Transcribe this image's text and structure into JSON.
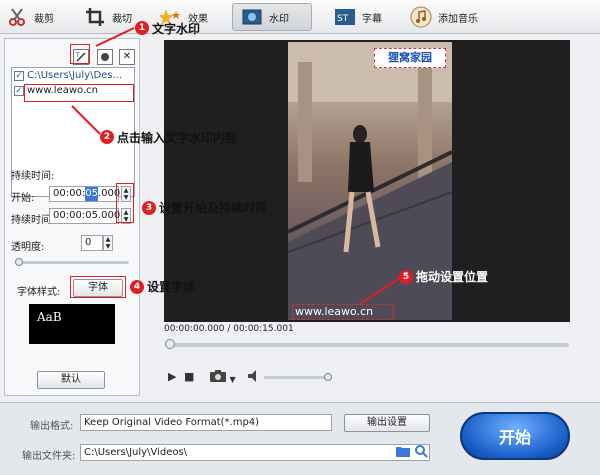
{
  "toolbar": {
    "items": [
      {
        "label": "裁剪",
        "icon": "scissors-icon"
      },
      {
        "label": "裁切",
        "icon": "crop-icon"
      },
      {
        "label": "效果",
        "icon": "effects-icon"
      },
      {
        "label": "水印",
        "icon": "watermark-icon"
      },
      {
        "label": "字幕",
        "icon": "subtitle-icon"
      },
      {
        "label": "添加音乐",
        "icon": "music-icon"
      }
    ],
    "active": "水印"
  },
  "left": {
    "list_items": [
      "C:\\Users\\July\\Des...",
      "www.leawo.cn"
    ],
    "duration_label": "持续时间:",
    "start_label": "开始:",
    "start_value": [
      "00",
      "00",
      "05",
      "000"
    ],
    "length_label": "持续时间",
    "length_value": [
      "00",
      "00",
      "05",
      "000"
    ],
    "opacity_label": "透明度:",
    "opacity_value": "0",
    "font_style_label": "字体样式:",
    "font_button": "字体",
    "font_preview": "AaB",
    "default_button": "默认"
  },
  "player": {
    "watermark_text": "www.leawo.cn",
    "logo_text": "狸窝家园",
    "time": "00:00:00.000 / 00:00:15.001"
  },
  "bottom": {
    "format_label": "输出格式:",
    "format_value": "Keep Original Video Format(*.mp4)",
    "settings_button": "输出设置",
    "folder_label": "输出文件夹:",
    "folder_value": "C:\\Users\\July\\Videos\\",
    "start_button": "开始"
  },
  "callouts": [
    {
      "num": "1",
      "text": "文字水印"
    },
    {
      "num": "2",
      "text": "点击输入文字水印内容"
    },
    {
      "num": "3",
      "text": "设置开始及持续时间"
    },
    {
      "num": "4",
      "text": "设置字体"
    },
    {
      "num": "5",
      "text": "拖动设置位置"
    }
  ],
  "colors": {
    "accent": "#e02020",
    "start_button": "#1a5ec9"
  }
}
